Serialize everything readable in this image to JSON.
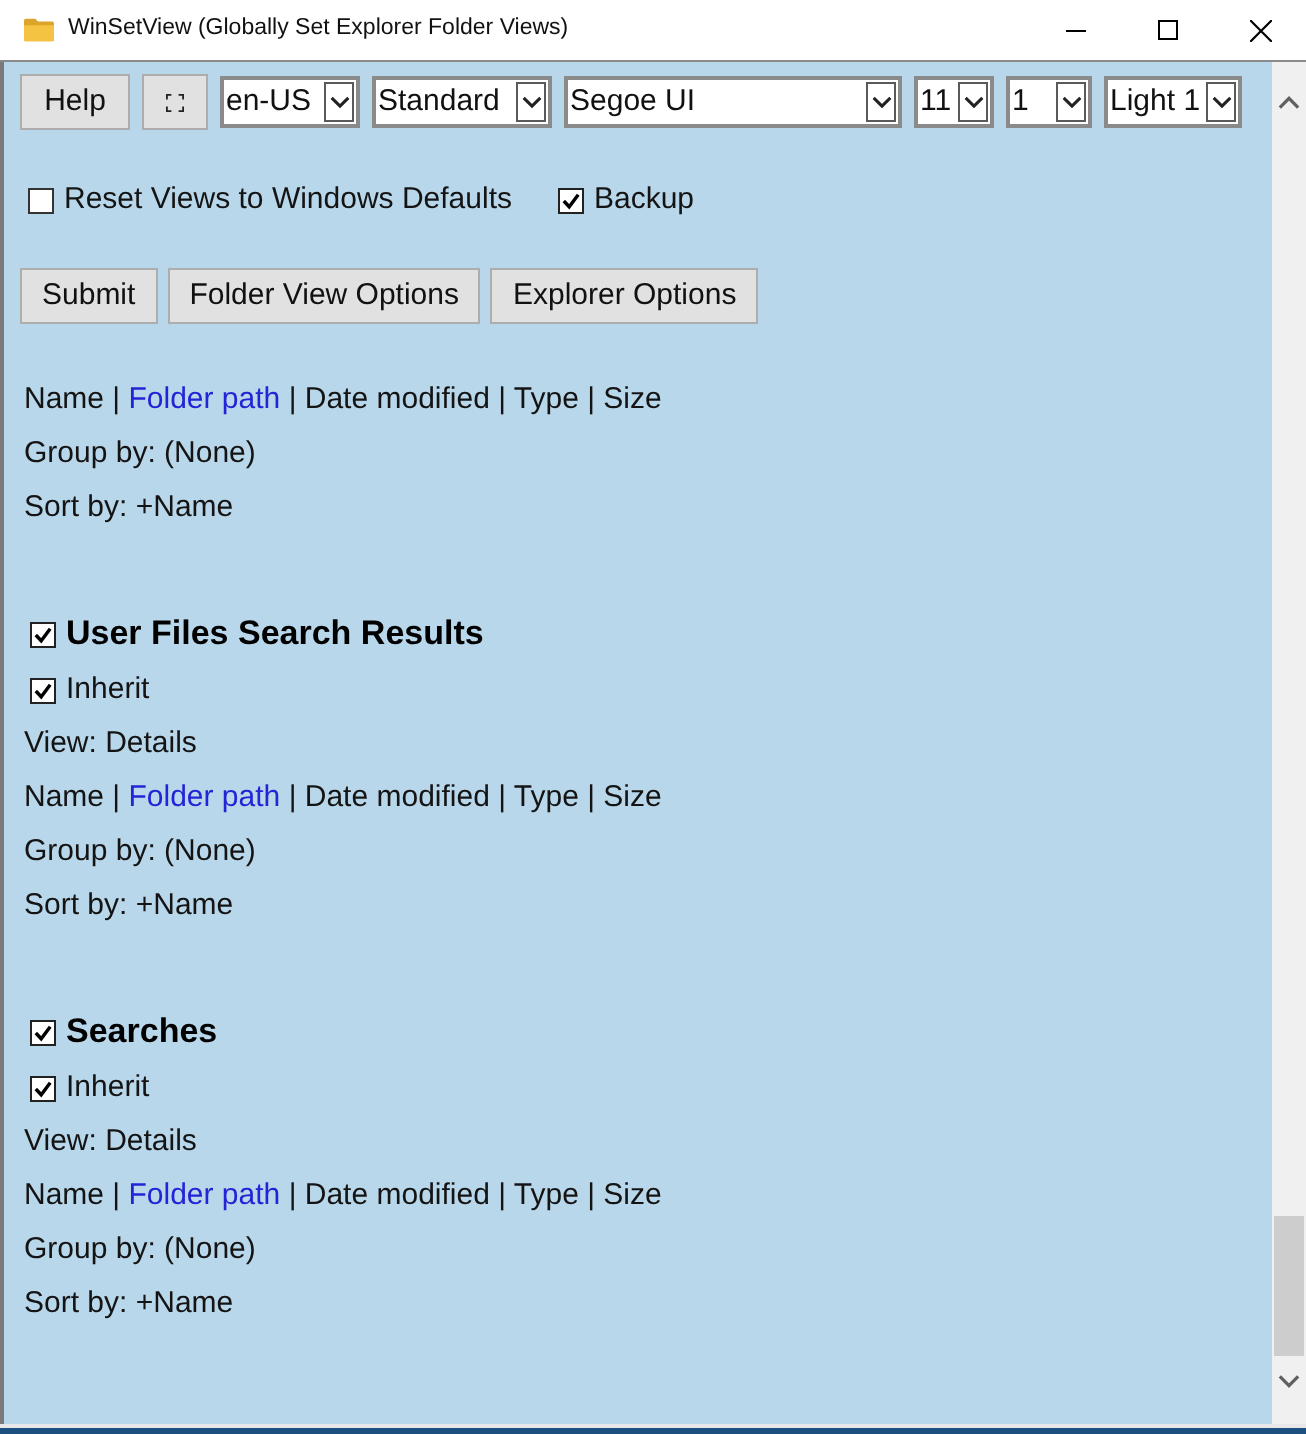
{
  "window": {
    "title": "WinSetView (Globally Set Explorer Folder Views)"
  },
  "toolbar": {
    "buttons": [
      {
        "kind": "text",
        "label": "Help"
      },
      {
        "kind": "fullscreen"
      }
    ],
    "dropdowns": [
      {
        "value": "en-US"
      },
      {
        "value": "Standard"
      },
      {
        "value": "Segoe UI"
      },
      {
        "value": "11"
      },
      {
        "value": "1"
      },
      {
        "value": "Light 1"
      }
    ]
  },
  "options": [
    {
      "label": "Reset Views to Windows Defaults",
      "checked": false
    },
    {
      "label": "Backup",
      "checked": true
    }
  ],
  "actions": [
    "Submit",
    "Folder View Options",
    "Explorer Options"
  ],
  "sections": [
    {
      "columns": [
        {
          "text": "Name |",
          "link": false
        },
        {
          "text": "Folder path",
          "link": true
        },
        {
          "text": "| Date modified | Type | Size",
          "link": false
        }
      ],
      "group_by": "Group by: (None)",
      "sort_by": "Sort by: +Name"
    },
    {
      "title": "User Files Search Results",
      "checked": true,
      "inherit": {
        "label": "Inherit",
        "checked": true
      },
      "view": "View: Details",
      "columns": [
        {
          "text": "Name |",
          "link": false
        },
        {
          "text": "Folder path",
          "link": true
        },
        {
          "text": "| Date modified | Type | Size",
          "link": false
        }
      ],
      "group_by": "Group by: (None)",
      "sort_by": "Sort by: +Name"
    },
    {
      "title": "Searches",
      "checked": true,
      "inherit": {
        "label": "Inherit",
        "checked": true
      },
      "view": "View: Details",
      "columns": [
        {
          "text": "Name |",
          "link": false
        },
        {
          "text": "Folder path",
          "link": true
        },
        {
          "text": "| Date modified | Type | Size",
          "link": false
        }
      ],
      "group_by": "Group by: (None)",
      "sort_by": "Sort by: +Name"
    }
  ]
}
